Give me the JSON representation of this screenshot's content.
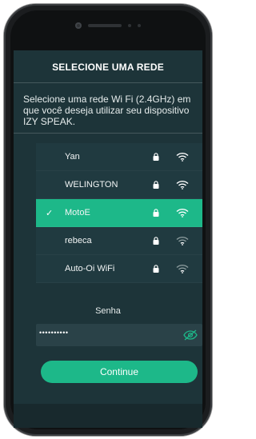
{
  "screen": {
    "title": "SELECIONE UMA REDE",
    "description": "Selecione uma rede Wi Fi (2.4GHz) em que você deseja utilizar seu dispositivo IZY SPEAK."
  },
  "networks": [
    {
      "name": "Yan",
      "locked": true,
      "selected": false,
      "signal": "strong",
      "lock_icon": "lock-icon",
      "signal_icon": "wifi-icon"
    },
    {
      "name": "WELINGTON",
      "locked": true,
      "selected": false,
      "signal": "strong",
      "lock_icon": "lock-icon",
      "signal_icon": "wifi-icon"
    },
    {
      "name": "MotoE",
      "locked": true,
      "selected": true,
      "signal": "strong",
      "lock_icon": "lock-icon",
      "signal_icon": "wifi-icon"
    },
    {
      "name": "rebeca",
      "locked": true,
      "selected": false,
      "signal": "weak",
      "lock_icon": "lock-icon",
      "signal_icon": "wifi-icon"
    },
    {
      "name": "Auto-Oi WiFi",
      "locked": true,
      "selected": false,
      "signal": "weak",
      "lock_icon": "lock-icon",
      "signal_icon": "wifi-icon"
    }
  ],
  "password": {
    "label": "Senha",
    "value": "••••••••••",
    "toggle_icon": "eye-off-icon"
  },
  "actions": {
    "continue_label": "Continue"
  },
  "colors": {
    "accent": "#1db889",
    "screen_bg": "#1d3439",
    "list_bg": "#203a40",
    "input_bg": "#2a4248"
  }
}
